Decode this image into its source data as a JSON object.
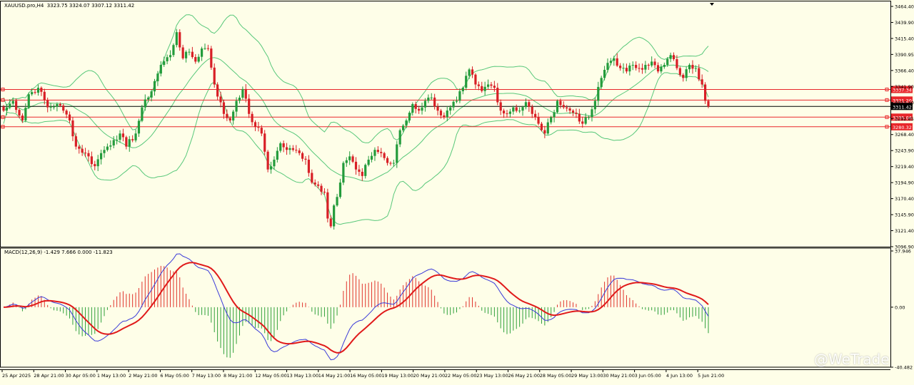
{
  "window": {
    "symbol_info": "XAUUSD.pro,H4  3323.75 3324.07 3307.12 3311.42",
    "indicator_info": "MACD(12,26,9) -1.429 7.666 0.000 -11.823",
    "watermark": "@WeTrade"
  },
  "colors": {
    "background": "#fefee8",
    "bull_candle": "#239b3b",
    "bear_candle": "#d81f26",
    "bollinger": "#58c87a",
    "hline": "#e8262a",
    "current_price_line": "#000000",
    "macd_line": "#3a3ad8",
    "signal_line": "#e01a1a",
    "hist_positive": "#e0322c",
    "hist_negative": "#2fa03a"
  },
  "chart_data": [
    {
      "type": "candlestick",
      "title": "XAUUSD.pro,H4",
      "ylim": [
        3096.9,
        3464.4
      ],
      "y_ticks": [
        "3464.40",
        "3439.90",
        "3415.40",
        "3390.95",
        "3366.40",
        "3341.90",
        "3317.40",
        "3292.85",
        "3268.40",
        "3243.90",
        "3219.40",
        "3194.90",
        "3170.40",
        "3145.90",
        "3121.40",
        "3096.90"
      ],
      "x_labels": [
        "25 Apr 2025",
        "28 Apr 21:00",
        "30 Apr 05:00",
        "1 May 13:00",
        "2 May 21:00",
        "6 May 05:00",
        "7 May 13:00",
        "8 May 21:00",
        "12 May 05:00",
        "13 May 13:00",
        "14 May 21:00",
        "16 May 05:00",
        "19 May 13:00",
        "20 May 21:00",
        "22 May 05:00",
        "23 May 13:00",
        "26 May 21:00",
        "28 May 05:00",
        "29 May 13:00",
        "30 May 21:00",
        "3 Jun 05:00",
        "4 Jun 13:00",
        "5 Jun 21:00"
      ],
      "horizontal_levels": [
        {
          "label": "3337.34",
          "value": 3337.34
        },
        {
          "label": "3321.20",
          "value": 3321.2
        },
        {
          "label": "3295.06",
          "value": 3295.06
        },
        {
          "label": "3280.32",
          "value": 3280.32
        }
      ],
      "current_price": {
        "label": "3311.42",
        "value": 3311.42
      },
      "close_path": [
        [
          0,
          3305
        ],
        [
          3,
          3320
        ],
        [
          6,
          3290
        ],
        [
          8,
          3330
        ],
        [
          11,
          3340
        ],
        [
          14,
          3310
        ],
        [
          17,
          3315
        ],
        [
          19,
          3305
        ],
        [
          21,
          3290
        ],
        [
          23,
          3250
        ],
        [
          26,
          3240
        ],
        [
          29,
          3220
        ],
        [
          31,
          3240
        ],
        [
          33,
          3250
        ],
        [
          35,
          3260
        ],
        [
          37,
          3270
        ],
        [
          39,
          3250
        ],
        [
          42,
          3270
        ],
        [
          44,
          3310
        ],
        [
          46,
          3325
        ],
        [
          48,
          3350
        ],
        [
          50,
          3375
        ],
        [
          53,
          3390
        ],
        [
          55,
          3425
        ],
        [
          57,
          3385
        ],
        [
          59,
          3395
        ],
        [
          61,
          3380
        ],
        [
          63,
          3400
        ],
        [
          65,
          3400
        ],
        [
          67,
          3345
        ],
        [
          70,
          3300
        ],
        [
          72,
          3290
        ],
        [
          74,
          3320
        ],
        [
          76,
          3338
        ],
        [
          78,
          3300
        ],
        [
          80,
          3280
        ],
        [
          82,
          3270
        ],
        [
          84,
          3215
        ],
        [
          86,
          3230
        ],
        [
          88,
          3255
        ],
        [
          90,
          3245
        ],
        [
          92,
          3245
        ],
        [
          94,
          3240
        ],
        [
          96,
          3230
        ],
        [
          98,
          3195
        ],
        [
          100,
          3190
        ],
        [
          102,
          3180
        ],
        [
          103,
          3140
        ],
        [
          104,
          3128
        ],
        [
          105,
          3160
        ],
        [
          107,
          3195
        ],
        [
          108,
          3225
        ],
        [
          110,
          3235
        ],
        [
          112,
          3215
        ],
        [
          114,
          3205
        ],
        [
          116,
          3230
        ],
        [
          118,
          3245
        ],
        [
          120,
          3240
        ],
        [
          122,
          3225
        ],
        [
          124,
          3225
        ],
        [
          126,
          3275
        ],
        [
          128,
          3290
        ],
        [
          130,
          3315
        ],
        [
          132,
          3305
        ],
        [
          134,
          3320
        ],
        [
          136,
          3325
        ],
        [
          138,
          3305
        ],
        [
          140,
          3295
        ],
        [
          142,
          3310
        ],
        [
          144,
          3320
        ],
        [
          146,
          3340
        ],
        [
          148,
          3368
        ],
        [
          150,
          3345
        ],
        [
          152,
          3335
        ],
        [
          154,
          3345
        ],
        [
          156,
          3340
        ],
        [
          158,
          3305
        ],
        [
          160,
          3300
        ],
        [
          162,
          3310
        ],
        [
          164,
          3305
        ],
        [
          166,
          3318
        ],
        [
          168,
          3300
        ],
        [
          170,
          3285
        ],
        [
          172,
          3270
        ],
        [
          174,
          3295
        ],
        [
          176,
          3320
        ],
        [
          178,
          3310
        ],
        [
          180,
          3305
        ],
        [
          182,
          3300
        ],
        [
          184,
          3285
        ],
        [
          186,
          3295
        ],
        [
          188,
          3320
        ],
        [
          190,
          3355
        ],
        [
          192,
          3378
        ],
        [
          194,
          3385
        ],
        [
          196,
          3370
        ],
        [
          198,
          3365
        ],
        [
          200,
          3375
        ],
        [
          202,
          3370
        ],
        [
          204,
          3375
        ],
        [
          206,
          3380
        ],
        [
          208,
          3365
        ],
        [
          210,
          3375
        ],
        [
          212,
          3390
        ],
        [
          214,
          3370
        ],
        [
          216,
          3355
        ],
        [
          218,
          3375
        ],
        [
          220,
          3370
        ],
        [
          222,
          3345
        ],
        [
          223,
          3320
        ],
        [
          224,
          3311.42
        ]
      ],
      "bars": 225
    },
    {
      "type": "macd",
      "title": "MACD(12,26,9)",
      "params": [
        12,
        26,
        9
      ],
      "values": {
        "histogram": -1.429,
        "macd": 7.666,
        "zero": 0.0,
        "signal": -11.823
      },
      "ylim": [
        -40.482,
        37.946
      ],
      "y_ticks": [
        "37.946",
        "0.00",
        "-40.482"
      ]
    }
  ]
}
